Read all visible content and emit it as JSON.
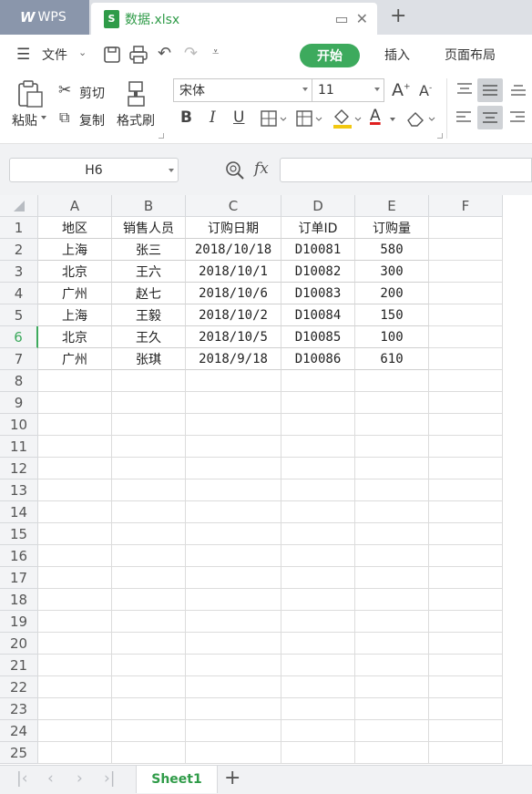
{
  "titlebar": {
    "app_tab": "WPS",
    "app_logo": "W",
    "doc_tab": "数据.xlsx",
    "doc_icon": "S",
    "new_tab": "+"
  },
  "menubar": {
    "file": "文件",
    "start": "开始",
    "insert": "插入",
    "page_layout": "页面布局"
  },
  "ribbon": {
    "paste": "粘贴",
    "cut": "剪切",
    "copy": "复制",
    "format_painter": "格式刷",
    "font_name": "宋体",
    "font_size": "11",
    "bold": "B",
    "italic": "I",
    "underline": "U",
    "font_color": "A"
  },
  "formula_bar": {
    "name_box": "H6",
    "fx": "fx",
    "formula": ""
  },
  "sheet": {
    "columns": [
      "A",
      "B",
      "C",
      "D",
      "E",
      "F"
    ],
    "rows": [
      "1",
      "2",
      "3",
      "4",
      "5",
      "6",
      "7",
      "8",
      "9",
      "10",
      "11",
      "12",
      "13",
      "14",
      "15",
      "16",
      "17",
      "18",
      "19",
      "20",
      "21",
      "22",
      "23",
      "24",
      "25"
    ],
    "active_row": "6",
    "headers": [
      "地区",
      "销售人员",
      "订购日期",
      "订单ID",
      "订购量"
    ],
    "data": [
      [
        "上海",
        "张三",
        "2018/10/18",
        "D10081",
        "580"
      ],
      [
        "北京",
        "王六",
        "2018/10/1",
        "D10082",
        "300"
      ],
      [
        "广州",
        "赵七",
        "2018/10/6",
        "D10083",
        "200"
      ],
      [
        "上海",
        "王毅",
        "2018/10/2",
        "D10084",
        "150"
      ],
      [
        "北京",
        "王久",
        "2018/10/5",
        "D10085",
        "100"
      ],
      [
        "广州",
        "张琪",
        "2018/9/18",
        "D10086",
        "610"
      ]
    ]
  },
  "sheet_tabs": {
    "active": "Sheet1",
    "add": "+"
  },
  "colors": {
    "accent": "#3daa5d",
    "tab_bar": "#dde0e5",
    "wps_tab": "#8a96ab"
  }
}
